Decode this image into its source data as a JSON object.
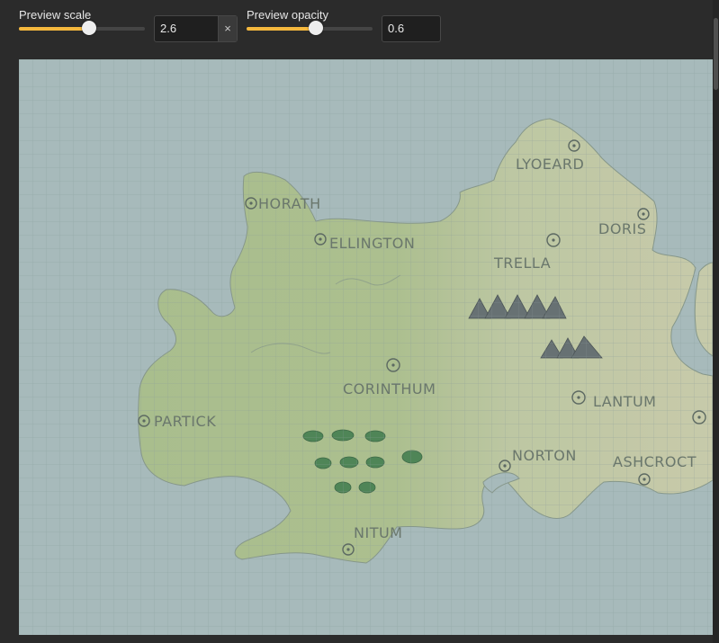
{
  "controls": {
    "scale": {
      "label": "Preview scale",
      "value": "2.6",
      "slider_fraction": 0.56,
      "clear_glyph": "×",
      "clear_icon": "close-icon"
    },
    "opacity": {
      "label": "Preview opacity",
      "value": "0.6",
      "slider_fraction": 0.55
    }
  },
  "colors": {
    "background": "#2b2b2b",
    "accent": "#f5b83d",
    "water": "#9fb4b4",
    "land_green": "#a6bb83",
    "land_yellow": "#c6c9a4",
    "forest": "#3f7a46",
    "grid": "#7f9090"
  },
  "map": {
    "places": [
      "HORATH",
      "ELLINGTON",
      "LYOEARD",
      "DORIS",
      "TRELLA",
      "CORINTHUM",
      "PARTICK",
      "LANTUM",
      "NORTON",
      "ASHCROCT",
      "NITUM"
    ]
  }
}
